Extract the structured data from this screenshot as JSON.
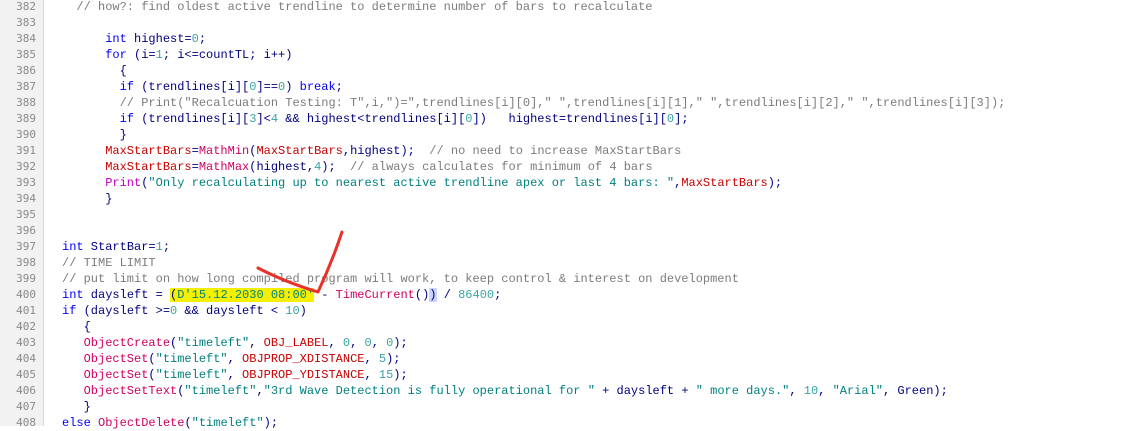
{
  "editor": {
    "lines": [
      {
        "n": "382",
        "segments": [
          {
            "t": "  // how?: find oldest active trendline to determine number of bars to recalculate",
            "c": "cmt"
          }
        ]
      },
      {
        "n": "383",
        "segments": []
      },
      {
        "n": "384",
        "segments": [
          {
            "t": "      int",
            "c": "kw"
          },
          {
            "t": " highest=",
            "c": "op"
          },
          {
            "t": "0",
            "c": "num"
          },
          {
            "t": ";",
            "c": "op"
          }
        ]
      },
      {
        "n": "385",
        "segments": [
          {
            "t": "      for",
            "c": "kw"
          },
          {
            "t": " (i=",
            "c": "op"
          },
          {
            "t": "1",
            "c": "num"
          },
          {
            "t": "; i<=countTL; i++)",
            "c": "op"
          }
        ]
      },
      {
        "n": "386",
        "segments": [
          {
            "t": "        {",
            "c": "op"
          }
        ]
      },
      {
        "n": "387",
        "segments": [
          {
            "t": "        if",
            "c": "kw"
          },
          {
            "t": " (trendlines[i][",
            "c": "op"
          },
          {
            "t": "0",
            "c": "num"
          },
          {
            "t": "]==",
            "c": "op"
          },
          {
            "t": "0",
            "c": "num"
          },
          {
            "t": ") ",
            "c": "op"
          },
          {
            "t": "break",
            "c": "kw"
          },
          {
            "t": ";",
            "c": "op"
          }
        ]
      },
      {
        "n": "388",
        "segments": [
          {
            "t": "        // Print(\"Recalcuation Testing: T\",i,\")=\",trendlines[i][0],\" \",trendlines[i][1],\" \",trendlines[i][2],\" \",trendlines[i][3]);",
            "c": "cmt"
          }
        ]
      },
      {
        "n": "389",
        "segments": [
          {
            "t": "        if",
            "c": "kw"
          },
          {
            "t": " (trendlines[i][",
            "c": "op"
          },
          {
            "t": "3",
            "c": "num"
          },
          {
            "t": "]<",
            "c": "op"
          },
          {
            "t": "4",
            "c": "num"
          },
          {
            "t": " && highest<trendlines[i][",
            "c": "op"
          },
          {
            "t": "0",
            "c": "num"
          },
          {
            "t": "])   highest=trendlines[i][",
            "c": "op"
          },
          {
            "t": "0",
            "c": "num"
          },
          {
            "t": "];",
            "c": "op"
          }
        ]
      },
      {
        "n": "390",
        "segments": [
          {
            "t": "        }",
            "c": "op"
          }
        ]
      },
      {
        "n": "391",
        "segments": [
          {
            "t": "      MaxStartBars",
            "c": "cst"
          },
          {
            "t": "=",
            "c": "op"
          },
          {
            "t": "MathMin",
            "c": "fn2"
          },
          {
            "t": "(",
            "c": "op"
          },
          {
            "t": "MaxStartBars",
            "c": "cst"
          },
          {
            "t": ",highest);  ",
            "c": "op"
          },
          {
            "t": "// no need to increase MaxStartBars",
            "c": "cmt"
          }
        ]
      },
      {
        "n": "392",
        "segments": [
          {
            "t": "      MaxStartBars",
            "c": "cst"
          },
          {
            "t": "=",
            "c": "op"
          },
          {
            "t": "MathMax",
            "c": "fn2"
          },
          {
            "t": "(highest,",
            "c": "op"
          },
          {
            "t": "4",
            "c": "num"
          },
          {
            "t": ");  ",
            "c": "op"
          },
          {
            "t": "// always calculates for minimum of 4 bars",
            "c": "cmt"
          }
        ]
      },
      {
        "n": "393",
        "segments": [
          {
            "t": "      Print",
            "c": "fn"
          },
          {
            "t": "(",
            "c": "op"
          },
          {
            "t": "\"Only recalculating up to nearest active trendline apex or last 4 bars: \"",
            "c": "str"
          },
          {
            "t": ",",
            "c": "op"
          },
          {
            "t": "MaxStartBars",
            "c": "cst"
          },
          {
            "t": ");",
            "c": "op"
          }
        ]
      },
      {
        "n": "394",
        "segments": [
          {
            "t": "      }",
            "c": "op"
          }
        ]
      },
      {
        "n": "395",
        "segments": []
      },
      {
        "n": "396",
        "segments": []
      },
      {
        "n": "397",
        "segments": [
          {
            "t": "int",
            "c": "kw"
          },
          {
            "t": " StartBar=",
            "c": "op"
          },
          {
            "t": "1",
            "c": "num"
          },
          {
            "t": ";",
            "c": "op"
          }
        ]
      },
      {
        "n": "398",
        "segments": [
          {
            "t": "// TIME LIMIT",
            "c": "cmt"
          }
        ]
      },
      {
        "n": "399",
        "segments": [
          {
            "t": "// put limit on how long compiled program will work, to keep control & interest on development",
            "c": "cmt"
          }
        ]
      },
      {
        "n": "400",
        "segments": [
          {
            "t": "int",
            "c": "kw"
          },
          {
            "t": " daysleft = ",
            "c": "op"
          },
          {
            "t": "(",
            "c": "op hl"
          },
          {
            "t": "D'15.12.2030 08:00'",
            "c": "str hl"
          },
          {
            "t": " - ",
            "c": "op"
          },
          {
            "t": "TimeCurrent",
            "c": "fn2"
          },
          {
            "t": "()",
            "c": "op"
          },
          {
            "t": ")",
            "c": "op hl2"
          },
          {
            "t": " / ",
            "c": "op"
          },
          {
            "t": "86400",
            "c": "num"
          },
          {
            "t": ";",
            "c": "op"
          }
        ]
      },
      {
        "n": "401",
        "segments": [
          {
            "t": "if",
            "c": "kw"
          },
          {
            "t": " (daysleft >=",
            "c": "op"
          },
          {
            "t": "0",
            "c": "num"
          },
          {
            "t": " && daysleft < ",
            "c": "op"
          },
          {
            "t": "10",
            "c": "num"
          },
          {
            "t": ")",
            "c": "op"
          }
        ]
      },
      {
        "n": "402",
        "segments": [
          {
            "t": "   {",
            "c": "op"
          }
        ]
      },
      {
        "n": "403",
        "segments": [
          {
            "t": "   ObjectCreate",
            "c": "fn2"
          },
          {
            "t": "(",
            "c": "op"
          },
          {
            "t": "\"timeleft\"",
            "c": "str"
          },
          {
            "t": ", ",
            "c": "op"
          },
          {
            "t": "OBJ_LABEL",
            "c": "cst"
          },
          {
            "t": ", ",
            "c": "op"
          },
          {
            "t": "0",
            "c": "num"
          },
          {
            "t": ", ",
            "c": "op"
          },
          {
            "t": "0",
            "c": "num"
          },
          {
            "t": ", ",
            "c": "op"
          },
          {
            "t": "0",
            "c": "num"
          },
          {
            "t": ");",
            "c": "op"
          }
        ]
      },
      {
        "n": "404",
        "segments": [
          {
            "t": "   ObjectSet",
            "c": "fn2"
          },
          {
            "t": "(",
            "c": "op"
          },
          {
            "t": "\"timeleft\"",
            "c": "str"
          },
          {
            "t": ", ",
            "c": "op"
          },
          {
            "t": "OBJPROP_XDISTANCE",
            "c": "cst"
          },
          {
            "t": ", ",
            "c": "op"
          },
          {
            "t": "5",
            "c": "num"
          },
          {
            "t": ");",
            "c": "op"
          }
        ]
      },
      {
        "n": "405",
        "segments": [
          {
            "t": "   ObjectSet",
            "c": "fn2"
          },
          {
            "t": "(",
            "c": "op"
          },
          {
            "t": "\"timeleft\"",
            "c": "str"
          },
          {
            "t": ", ",
            "c": "op"
          },
          {
            "t": "OBJPROP_YDISTANCE",
            "c": "cst"
          },
          {
            "t": ", ",
            "c": "op"
          },
          {
            "t": "15",
            "c": "num"
          },
          {
            "t": ");",
            "c": "op"
          }
        ]
      },
      {
        "n": "406",
        "segments": [
          {
            "t": "   ObjectSetText",
            "c": "fn2"
          },
          {
            "t": "(",
            "c": "op"
          },
          {
            "t": "\"timeleft\"",
            "c": "str"
          },
          {
            "t": ",",
            "c": "op"
          },
          {
            "t": "\"3rd Wave Detection is fully operational for \"",
            "c": "str"
          },
          {
            "t": " + daysleft + ",
            "c": "op"
          },
          {
            "t": "\" more days.\"",
            "c": "str"
          },
          {
            "t": ", ",
            "c": "op"
          },
          {
            "t": "10",
            "c": "num"
          },
          {
            "t": ", ",
            "c": "op"
          },
          {
            "t": "\"Arial\"",
            "c": "str"
          },
          {
            "t": ", Green);",
            "c": "op"
          }
        ]
      },
      {
        "n": "407",
        "segments": [
          {
            "t": "   }",
            "c": "op"
          }
        ]
      },
      {
        "n": "408",
        "segments": [
          {
            "t": "else",
            "c": "kw"
          },
          {
            "t": " ",
            "c": "op"
          },
          {
            "t": "ObjectDelete",
            "c": "fn2"
          },
          {
            "t": "(",
            "c": "op"
          },
          {
            "t": "\"timeleft\"",
            "c": "str"
          },
          {
            "t": ");",
            "c": "op"
          }
        ]
      }
    ]
  },
  "annotation": {
    "icon": "red-checkmark-annotation",
    "color": "#e8312b"
  }
}
